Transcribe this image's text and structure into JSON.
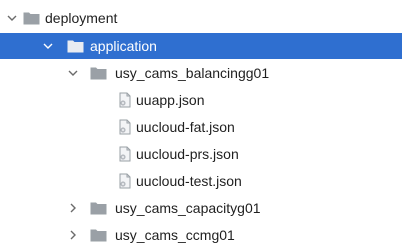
{
  "tree": {
    "deployment": {
      "label": "deployment",
      "icon": "folder-icon",
      "expanded": true
    },
    "application": {
      "label": "application",
      "icon": "folder-icon",
      "expanded": true,
      "selected": true
    },
    "balancing": {
      "label": "usy_cams_balancingg01",
      "icon": "folder-icon",
      "expanded": true
    },
    "files": [
      {
        "label": "uuapp.json",
        "icon": "json-file-icon"
      },
      {
        "label": "uucloud-fat.json",
        "icon": "json-file-icon"
      },
      {
        "label": "uucloud-prs.json",
        "icon": "json-file-icon"
      },
      {
        "label": "uucloud-test.json",
        "icon": "json-file-icon"
      }
    ],
    "capacity": {
      "label": "usy_cams_capacityg01",
      "icon": "folder-icon",
      "expanded": false
    },
    "ccmg": {
      "label": "usy_cams_ccmg01",
      "icon": "folder-icon",
      "expanded": false
    }
  },
  "colors": {
    "selection": "#2f6fd0",
    "folder": "#9aa0a6",
    "text": "#1f1f1f"
  }
}
